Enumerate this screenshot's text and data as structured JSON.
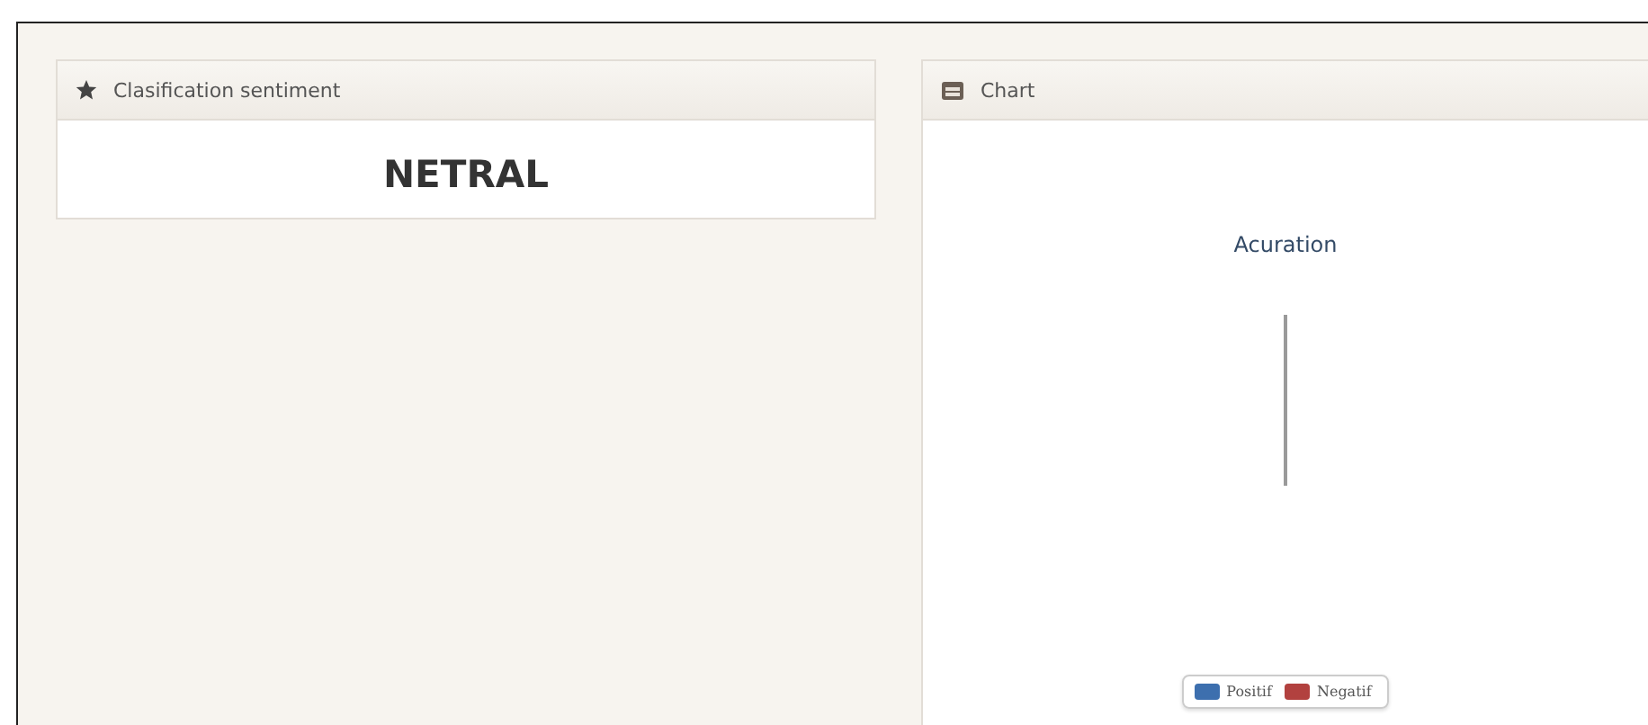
{
  "panels": [
    {
      "kind": "result",
      "title": "Clasification sentiment",
      "value": "NETRAL"
    },
    {
      "kind": "chart",
      "title": "Chart",
      "chart_title": "Acuration",
      "legend": [
        {
          "label": "Positif",
          "color": "#3d6fae"
        },
        {
          "label": "Negatif",
          "color": "#b2413f"
        }
      ]
    }
  ]
}
